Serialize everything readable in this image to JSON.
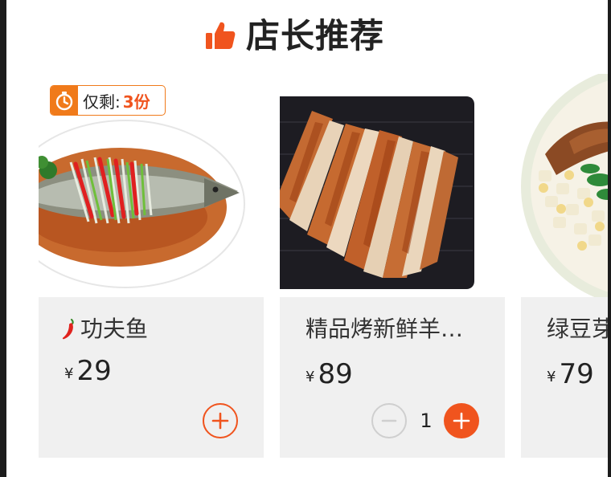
{
  "section": {
    "title": "店长推荐",
    "icon": "thumbs-up-icon"
  },
  "colors": {
    "accent": "#f0541e",
    "badge": "#f07a1a",
    "card_bg": "#f0f0f0"
  },
  "items": [
    {
      "name": "功夫鱼",
      "spicy": true,
      "currency": "¥",
      "price": "29",
      "badge": {
        "label": "仅剩:",
        "count": "3份"
      }
    },
    {
      "name": "精品烤新鲜羊…",
      "spicy": false,
      "currency": "¥",
      "price": "89",
      "quantity": "1"
    },
    {
      "name": "绿豆芽",
      "spicy": false,
      "currency": "¥",
      "price": "79"
    }
  ]
}
